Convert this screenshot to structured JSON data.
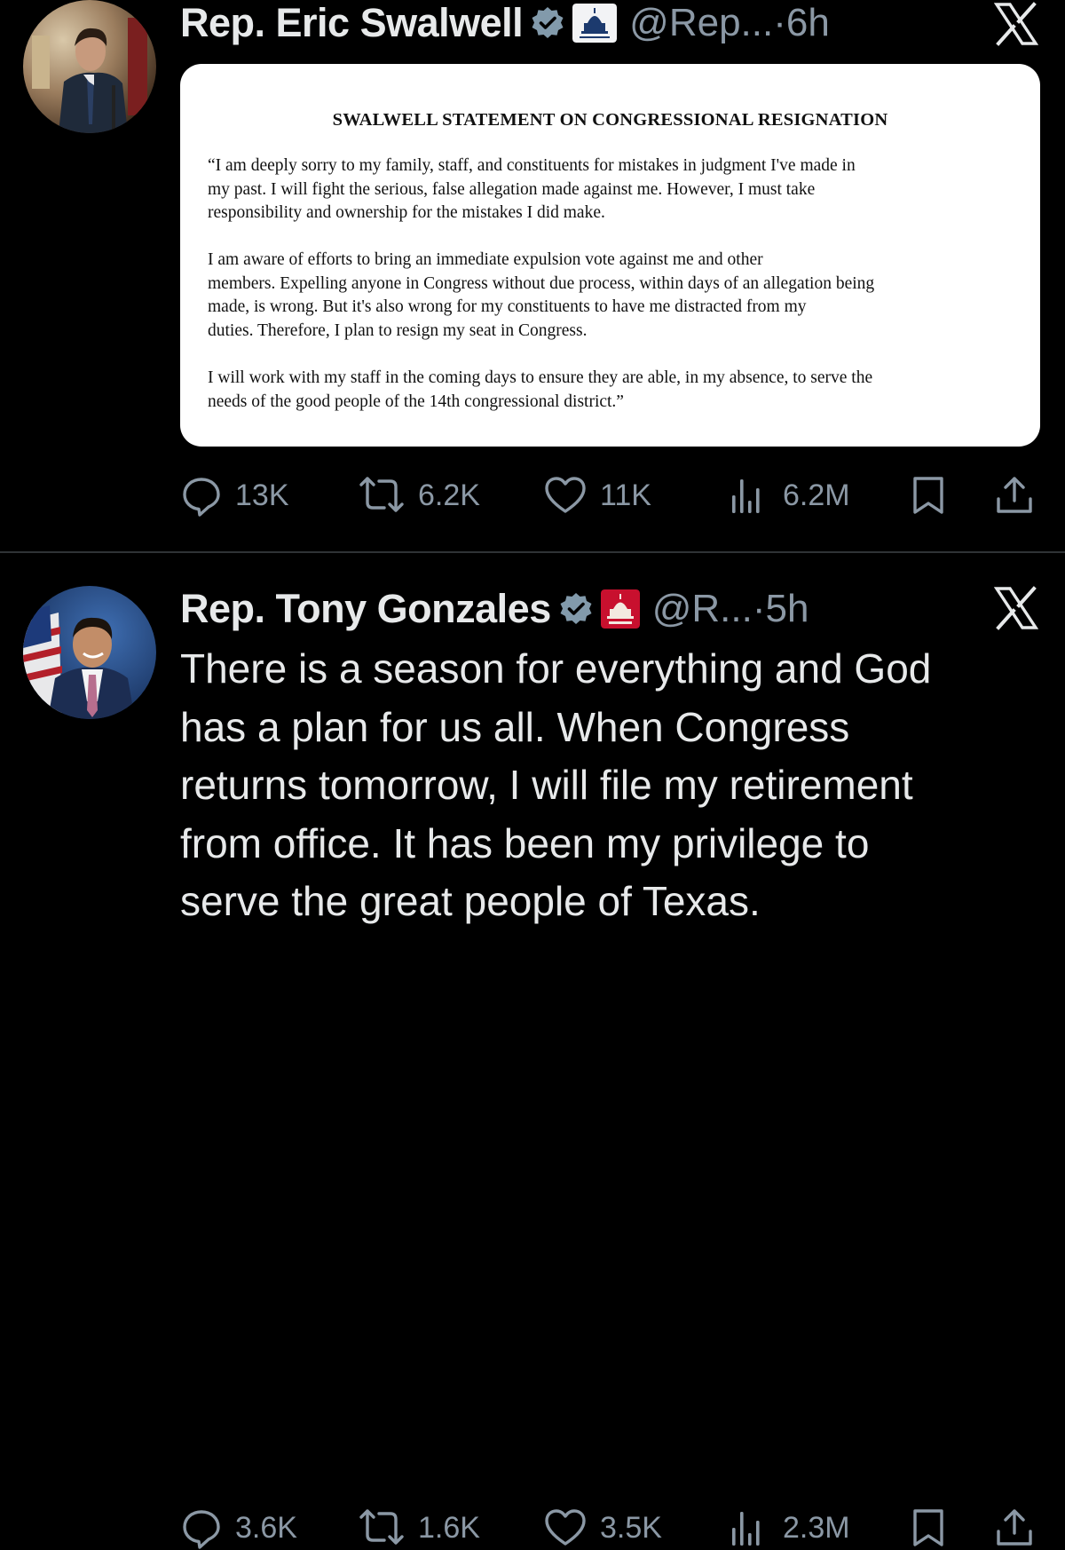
{
  "tweets": [
    {
      "name": "Rep. Eric Swalwell",
      "handle": "@Rep...",
      "time_sep": " · ",
      "time": "6h",
      "icons": {
        "verified": "verified-badge-icon",
        "affiliation": "house-democrats-capitol-icon",
        "platform": "x-logo-icon"
      },
      "document": {
        "title": "SWALWELL STATEMENT ON CONGRESSIONAL RESIGNATION",
        "lines": [
          [
            "“I am deeply sorry to my family, staff, and constituents for mistakes in judgment I've made in",
            "my past.  I will fight the serious, false allegation made against me. However, I must take",
            "responsibility and ownership for the mistakes I did make."
          ],
          [
            "I am aware of efforts to bring an immediate expulsion vote against me and other",
            "members.  Expelling anyone in Congress without due process, within days of an allegation being",
            "made, is wrong.  But it's also wrong for my constituents to have me distracted from my",
            "duties.  Therefore, I plan to resign my seat in Congress."
          ],
          [
            "I will work with my staff in the coming days to ensure they are able, in my absence, to serve the",
            "needs of the good people of the 14th congressional district.”"
          ]
        ]
      },
      "stats": {
        "replies": "13K",
        "reposts": "6.2K",
        "likes": "11K",
        "views": "6.2M"
      }
    },
    {
      "name": "Rep. Tony Gonzales",
      "handle": "@R...",
      "time_sep": " · ",
      "time": "5h",
      "icons": {
        "verified": "verified-badge-icon",
        "affiliation": "house-gop-capitol-icon",
        "platform": "x-logo-icon"
      },
      "text_lines": [
        "There is a season for everything and God",
        "has a plan for us all. When Congress",
        "returns tomorrow, I will file my retirement",
        "from office. It has been my privilege to",
        "serve the great people of Texas."
      ],
      "stats": {
        "replies": "3.6K",
        "reposts": "1.6K",
        "likes": "3.5K",
        "views": "2.3M"
      }
    }
  ],
  "colors": {
    "background": "#000000",
    "primary_text": "#e7e9ea",
    "secondary_text": "#8b98a5",
    "divider": "#2f3336",
    "verified_badge": "#829aab",
    "gop_red": "#c8102e"
  }
}
